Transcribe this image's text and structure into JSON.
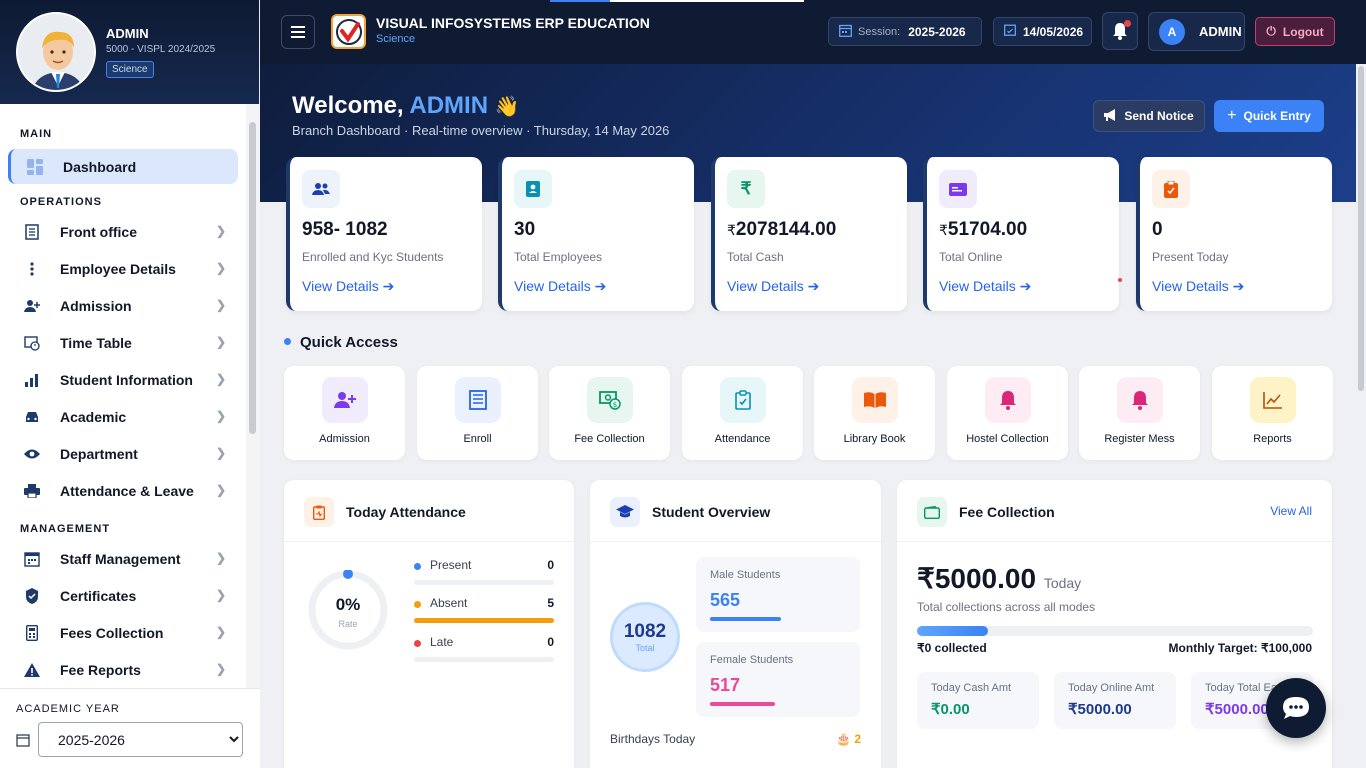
{
  "sidebar": {
    "profile": {
      "name": "ADMIN",
      "id": "5000 - VISPL 2024/2025",
      "stream": "Science"
    },
    "sections": [
      {
        "title": "MAIN",
        "items": [
          {
            "label": "Dashboard",
            "icon": "dashboard-icon",
            "active": true
          }
        ]
      },
      {
        "title": "OPERATIONS",
        "items": [
          {
            "label": "Front office",
            "icon": "front-office-icon"
          },
          {
            "label": "Employee Details",
            "icon": "more-vertical-icon"
          },
          {
            "label": "Admission",
            "icon": "add-user-icon"
          },
          {
            "label": "Time Table",
            "icon": "timetable-icon"
          },
          {
            "label": "Student Information",
            "icon": "bar-chart-icon"
          },
          {
            "label": "Academic",
            "icon": "car-icon"
          },
          {
            "label": "Department",
            "icon": "eye-icon"
          },
          {
            "label": "Attendance & Leave",
            "icon": "printer-icon"
          }
        ]
      },
      {
        "title": "MANAGEMENT",
        "items": [
          {
            "label": "Staff Management",
            "icon": "calendar-icon"
          },
          {
            "label": "Certificates",
            "icon": "certificate-icon"
          },
          {
            "label": "Fees Collection",
            "icon": "calculator-icon"
          },
          {
            "label": "Fee Reports",
            "icon": "warning-icon"
          }
        ]
      }
    ],
    "academic_year": {
      "label": "ACADEMIC YEAR",
      "value": "2025-2026"
    }
  },
  "topbar": {
    "app_name": "VISUAL INFOSYSTEMS ERP EDUCATION",
    "app_sub": "Science",
    "session_label": "Session:",
    "session_value": "2025-2026",
    "date": "14/05/2026",
    "user_initial": "A",
    "user_name": "ADMIN",
    "logout": "Logout"
  },
  "hero": {
    "welcome": "Welcome,",
    "name": "ADMIN",
    "wave": "👋",
    "subtitle": "Branch Dashboard · Real-time overview · Thursday, 14 May 2026",
    "send_notice": "Send Notice",
    "quick_entry": "Quick Entry"
  },
  "stats": [
    {
      "value": "958- 1082",
      "currency": "",
      "label": "Enrolled and Kyc Students",
      "link": "View Details",
      "icon": "users-icon",
      "color": "#1e40af",
      "bg": "#eef2fb"
    },
    {
      "value": "30",
      "currency": "",
      "label": "Total Employees",
      "link": "View Details",
      "icon": "id-badge-icon",
      "color": "#0891b2",
      "bg": "#e6f6f9"
    },
    {
      "value": "2078144.00",
      "currency": "₹",
      "label": "Total Cash",
      "link": "View Details",
      "icon": "rupee-icon",
      "color": "#059669",
      "bg": "#e7f6ef"
    },
    {
      "value": "51704.00",
      "currency": "₹",
      "label": "Total Online",
      "link": "View Details",
      "icon": "card-icon",
      "color": "#7c3aed",
      "bg": "#f1ecfc"
    },
    {
      "value": "0",
      "currency": "",
      "label": "Present Today",
      "link": "View Details",
      "icon": "clipboard-icon",
      "color": "#ea580c",
      "bg": "#fdf1e8"
    }
  ],
  "quick_access": {
    "title": "Quick Access",
    "items": [
      {
        "label": "Admission",
        "icon": "add-user-icon",
        "color": "#7c3aed",
        "bg": "#f1ecfc"
      },
      {
        "label": "Enroll",
        "icon": "document-icon",
        "color": "#2563eb",
        "bg": "#eaf1fc"
      },
      {
        "label": "Fee Collection",
        "icon": "cash-icon",
        "color": "#059669",
        "bg": "#e7f6ef"
      },
      {
        "label": "Attendance",
        "icon": "clipboard-check-icon",
        "color": "#0891b2",
        "bg": "#e6f6f9"
      },
      {
        "label": "Library Book",
        "icon": "book-icon",
        "color": "#ea580c",
        "bg": "#fdf1e8"
      },
      {
        "label": "Hostel Collection",
        "icon": "bell-icon",
        "color": "#db2777",
        "bg": "#fdecf3"
      },
      {
        "label": "Register Mess",
        "icon": "bell-icon",
        "color": "#db2777",
        "bg": "#fdecf3"
      },
      {
        "label": "Reports",
        "icon": "trend-chart-icon",
        "color": "#b45309",
        "bg": "#fdf3c7"
      }
    ]
  },
  "attendance": {
    "title": "Today Attendance",
    "percent": "0%",
    "rate_label": "Rate",
    "rows": [
      {
        "name": "Present",
        "value": "0",
        "color": "#3b82f6",
        "fill": 0
      },
      {
        "name": "Absent",
        "value": "5",
        "color": "#f59e0b",
        "fill": 1
      },
      {
        "name": "Late",
        "value": "0",
        "color": "#ef4444",
        "fill": 0
      }
    ]
  },
  "overview": {
    "title": "Student Overview",
    "total": "1082",
    "total_label": "Total",
    "male_label": "Male Students",
    "male_value": "565",
    "male_fraction": 0.52,
    "female_label": "Female Students",
    "female_value": "517",
    "female_fraction": 0.48,
    "birthday_label": "Birthdays Today",
    "birthday_value": "2"
  },
  "fees": {
    "title": "Fee Collection",
    "view_all": "View All",
    "amount": "₹5000.00",
    "amount_suffix": "Today",
    "subtitle": "Total collections across all modes",
    "collected": "₹0 collected",
    "target": "Monthly Target: ₹100,000",
    "progress": 0.18,
    "boxes": [
      {
        "label": "Today Cash Amt",
        "value": "₹0.00",
        "color": "#059669"
      },
      {
        "label": "Today Online Amt",
        "value": "₹5000.00",
        "color": "#1e3a8a"
      },
      {
        "label": "Today Total Ea",
        "value": "₹5000.00",
        "color": "#7c3aed"
      }
    ]
  }
}
